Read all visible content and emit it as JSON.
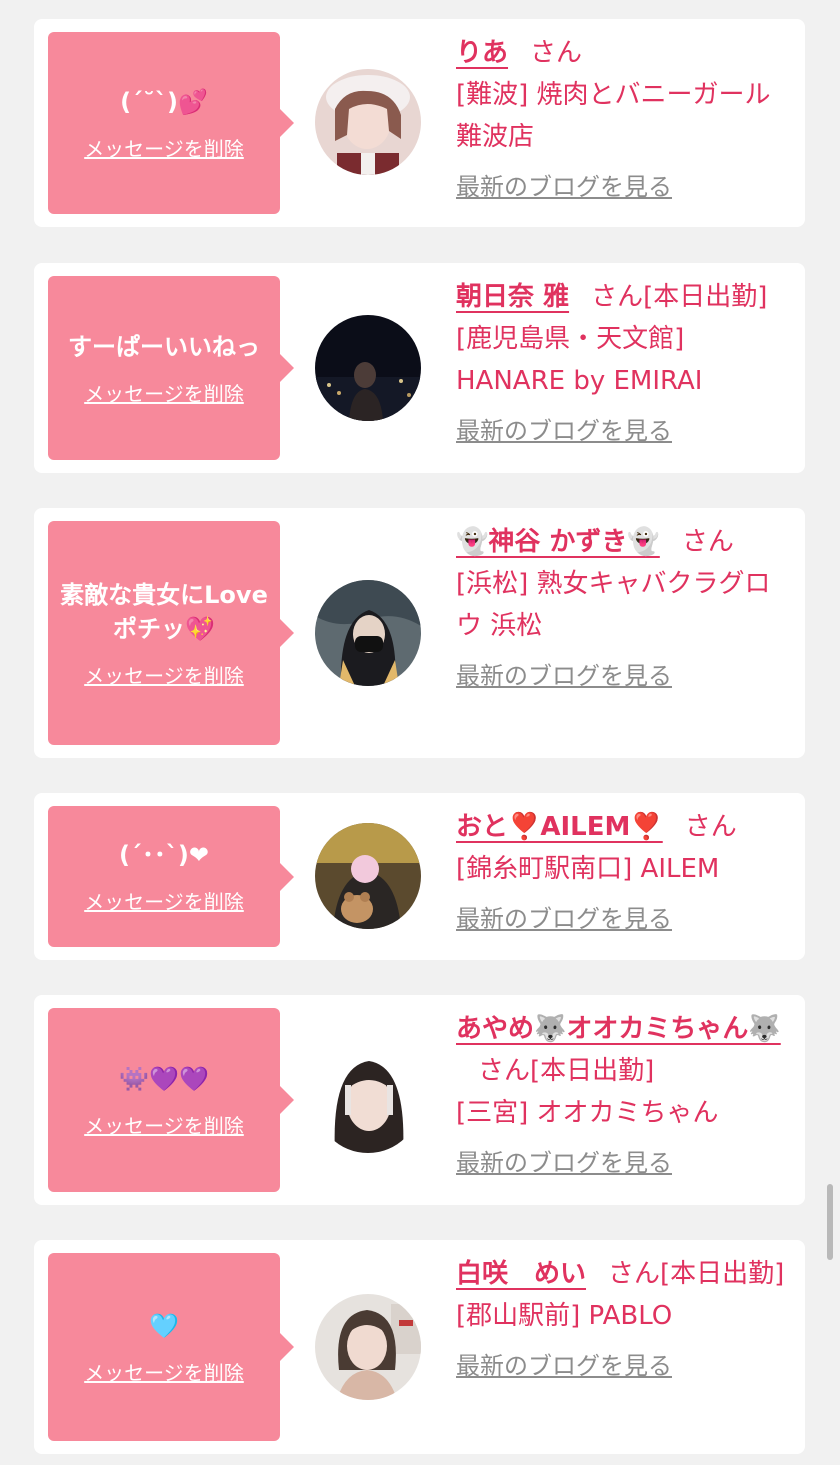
{
  "entries": [
    {
      "message": "(ˊ˘ˋ)💕",
      "delete_label": "メッセージを削除",
      "name": "りあ",
      "honorific": "さん",
      "status": "",
      "store": "[難波] 焼肉とバニーガール難波店",
      "blog_label": "最新のブログを見る"
    },
    {
      "message": "すーぱーいいねっ",
      "delete_label": "メッセージを削除",
      "name": "朝日奈 雅",
      "honorific": "さん",
      "status": "[本日出勤]",
      "store": "[鹿児島県・天文館] HANARE by EMIRAI",
      "blog_label": "最新のブログを見る"
    },
    {
      "message": "素敵な貴女にLoveポチッ💖",
      "delete_label": "メッセージを削除",
      "name": "👻神谷 かずき👻",
      "honorific": "さん",
      "status": "",
      "store": "[浜松] 熟女キャバクラグロウ 浜松",
      "blog_label": "最新のブログを見る"
    },
    {
      "message": "(ˊ･･ˋ)❤",
      "delete_label": "メッセージを削除",
      "name": "おと❣️AILEM❣️",
      "honorific": "さん",
      "status": "",
      "store": "[錦糸町駅南口] AILEM",
      "blog_label": "最新のブログを見る"
    },
    {
      "message": "👾💜💜",
      "delete_label": "メッセージを削除",
      "name": "あやめ🐺オオカミちゃん🐺",
      "honorific": "さん",
      "status": "[本日出勤]",
      "store": "[三宮] オオカミちゃん",
      "blog_label": "最新のブログを見る"
    },
    {
      "message": "🩵",
      "delete_label": "メッセージを削除",
      "name": "白咲　めい",
      "honorific": "さん",
      "status": "[本日出勤]",
      "store": "[郡山駅前] PABLO",
      "blog_label": "最新のブログを見る"
    }
  ]
}
